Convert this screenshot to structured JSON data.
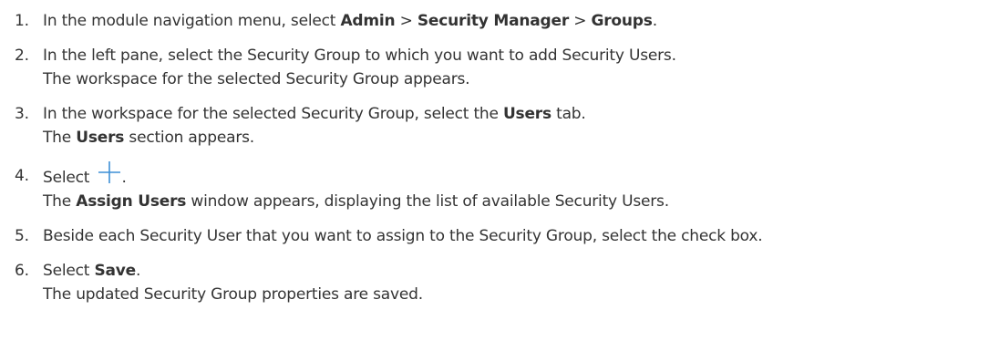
{
  "steps": [
    {
      "number": "1.",
      "lines": [
        {
          "parts": [
            {
              "text": "In the module navigation menu, select ",
              "bold": false
            },
            {
              "text": "Admin",
              "bold": true
            },
            {
              "text": " > ",
              "bold": false
            },
            {
              "text": "Security Manager",
              "bold": true
            },
            {
              "text": " > ",
              "bold": false
            },
            {
              "text": "Groups",
              "bold": true
            },
            {
              "text": ".",
              "bold": false
            }
          ]
        }
      ]
    },
    {
      "number": "2.",
      "lines": [
        {
          "parts": [
            {
              "text": "In the left pane, select the Security Group to which you want to add Security Users.",
              "bold": false
            }
          ]
        },
        {
          "parts": [
            {
              "text": "The workspace for the selected Security Group appears.",
              "bold": false
            }
          ]
        }
      ]
    },
    {
      "number": "3.",
      "lines": [
        {
          "parts": [
            {
              "text": "In the workspace for the selected Security Group, select the ",
              "bold": false
            },
            {
              "text": "Users",
              "bold": true
            },
            {
              "text": " tab.",
              "bold": false
            }
          ]
        },
        {
          "parts": [
            {
              "text": "The ",
              "bold": false
            },
            {
              "text": "Users",
              "bold": true
            },
            {
              "text": " section appears.",
              "bold": false
            }
          ]
        }
      ]
    },
    {
      "number": "4.",
      "icon": "plus-icon",
      "lines": [
        {
          "parts": [
            {
              "text": "Select ",
              "bold": false
            },
            {
              "icon": "plus-icon"
            },
            {
              "text": ".",
              "bold": false
            }
          ]
        },
        {
          "parts": [
            {
              "text": "The ",
              "bold": false
            },
            {
              "text": "Assign Users",
              "bold": true
            },
            {
              "text": " window appears, displaying the list of available Security Users.",
              "bold": false
            }
          ]
        }
      ]
    },
    {
      "number": "5.",
      "lines": [
        {
          "parts": [
            {
              "text": "Beside each Security User that you want to assign to the Security Group, select the check box.",
              "bold": false
            }
          ]
        }
      ]
    },
    {
      "number": "6.",
      "lines": [
        {
          "parts": [
            {
              "text": "Select ",
              "bold": false
            },
            {
              "text": "Save",
              "bold": true
            },
            {
              "text": ".",
              "bold": false
            }
          ]
        },
        {
          "parts": [
            {
              "text": "The updated Security Group properties are saved.",
              "bold": false
            }
          ]
        }
      ]
    }
  ],
  "colors": {
    "text": "#333333",
    "icon": "#3d8fd6"
  }
}
